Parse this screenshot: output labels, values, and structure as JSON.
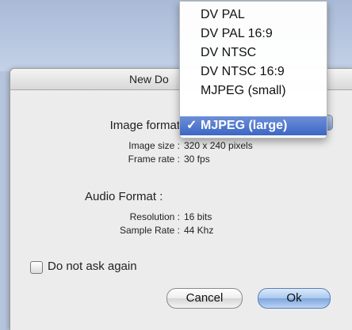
{
  "dialog": {
    "title": "New Do"
  },
  "video": {
    "image_format_label": "Image format",
    "image_size_label": "Image size :",
    "image_size_value": "320 x 240 pixels",
    "frame_rate_label": "Frame rate :",
    "frame_rate_value": "30 fps"
  },
  "audio": {
    "heading": "Audio Format :",
    "resolution_label": "Resolution :",
    "resolution_value": "16 bits",
    "sample_rate_label": "Sample Rate :",
    "sample_rate_value": "44 Khz"
  },
  "format_menu": {
    "items": [
      {
        "label": "DV PAL"
      },
      {
        "label": "DV PAL 16:9"
      },
      {
        "label": "DV NTSC"
      },
      {
        "label": "DV NTSC 16:9"
      },
      {
        "label": "MJPEG (small)"
      },
      {
        "label": "MJPEG (large)"
      }
    ],
    "selected_index": 5,
    "check_mark": "✓"
  },
  "options": {
    "do_not_ask_label": "Do not ask again",
    "do_not_ask_checked": false
  },
  "buttons": {
    "cancel": "Cancel",
    "ok": "Ok"
  },
  "colors": {
    "selection": "#3c67c4",
    "default_button": "#7fa6dc"
  }
}
